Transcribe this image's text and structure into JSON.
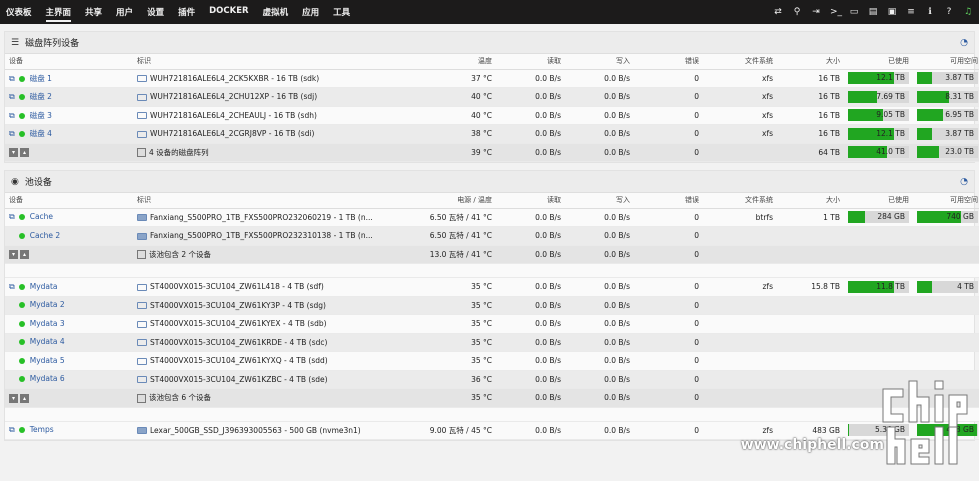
{
  "nav": {
    "items": [
      "仪表板",
      "主界面",
      "共享",
      "用户",
      "设置",
      "插件",
      "DOCKER",
      "虚拟机",
      "应用",
      "工具"
    ],
    "active": "主界面"
  },
  "array": {
    "title": "磁盘阵列设备",
    "headers": [
      "设备",
      "标识",
      "温度",
      "读取",
      "写入",
      "错误",
      "文件系统",
      "大小",
      "已使用",
      "可用空间"
    ],
    "rows": [
      {
        "device": "磁盘 1",
        "id": "WUH721816ALE6L4_2CK5KXBR - 16 TB (sdk)",
        "temp": "37 °C",
        "read": "0.0 B/s",
        "write": "0.0 B/s",
        "errors": "0",
        "fs": "xfs",
        "size": "16 TB",
        "used": "12.1 TB",
        "used_pct": 0.76,
        "free": "3.87 TB",
        "free_pct": 0.24
      },
      {
        "device": "磁盘 2",
        "id": "WUH721816ALE6L4_2CHU12XP - 16 TB (sdj)",
        "temp": "40 °C",
        "read": "0.0 B/s",
        "write": "0.0 B/s",
        "errors": "0",
        "fs": "xfs",
        "size": "16 TB",
        "used": "7.69 TB",
        "used_pct": 0.48,
        "free": "8.31 TB",
        "free_pct": 0.52
      },
      {
        "device": "磁盘 3",
        "id": "WUH721816ALE6L4_2CHEAULJ - 16 TB (sdh)",
        "temp": "40 °C",
        "read": "0.0 B/s",
        "write": "0.0 B/s",
        "errors": "0",
        "fs": "xfs",
        "size": "16 TB",
        "used": "9.05 TB",
        "used_pct": 0.57,
        "free": "6.95 TB",
        "free_pct": 0.43
      },
      {
        "device": "磁盘 4",
        "id": "WUH721816ALE6L4_2CGRJ8VP - 16 TB (sdi)",
        "temp": "38 °C",
        "read": "0.0 B/s",
        "write": "0.0 B/s",
        "errors": "0",
        "fs": "xfs",
        "size": "16 TB",
        "used": "12.1 TB",
        "used_pct": 0.76,
        "free": "3.87 TB",
        "free_pct": 0.24
      }
    ],
    "total": {
      "id": "4 设备的磁盘阵列",
      "temp": "39 °C",
      "read": "0.0 B/s",
      "write": "0.0 B/s",
      "errors": "0",
      "size": "64 TB",
      "used": "41.0 TB",
      "used_pct": 0.64,
      "free": "23.0 TB",
      "free_pct": 0.36
    }
  },
  "pool": {
    "title": "池设备",
    "headers": [
      "设备",
      "标识",
      "电源 / 温度",
      "读取",
      "写入",
      "错误",
      "文件系统",
      "大小",
      "已使用",
      "可用空间"
    ],
    "cache": [
      {
        "device": "Cache",
        "id": "Fanxiang_S500PRO_1TB_FXS500PRO232060219 - 1 TB (n...",
        "temp": "6.50 瓦特 / 41 °C",
        "read": "0.0 B/s",
        "write": "0.0 B/s",
        "errors": "0",
        "fs": "btrfs",
        "size": "1 TB",
        "used": "284 GB",
        "used_pct": 0.28,
        "free": "740 GB",
        "free_pct": 0.72
      },
      {
        "device": "Cache 2",
        "id": "Fanxiang_S500PRO_1TB_FXS500PRO232310138 - 1 TB (n...",
        "temp": "6.50 瓦特 / 41 °C",
        "read": "0.0 B/s",
        "write": "0.0 B/s",
        "errors": "0"
      }
    ],
    "cache_total": {
      "id": "该池包含 2 个设备",
      "temp": "13.0 瓦特 / 41 °C",
      "read": "0.0 B/s",
      "write": "0.0 B/s",
      "errors": "0"
    },
    "mydata": [
      {
        "device": "Mydata",
        "id": "ST4000VX015-3CU104_ZW61L418 - 4 TB (sdf)",
        "temp": "35 °C",
        "read": "0.0 B/s",
        "write": "0.0 B/s",
        "errors": "0",
        "fs": "zfs",
        "size": "15.8 TB",
        "used": "11.8 TB",
        "used_pct": 0.75,
        "free": "4 TB",
        "free_pct": 0.25
      },
      {
        "device": "Mydata 2",
        "id": "ST4000VX015-3CU104_ZW61KY3P - 4 TB (sdg)",
        "temp": "35 °C",
        "read": "0.0 B/s",
        "write": "0.0 B/s",
        "errors": "0"
      },
      {
        "device": "Mydata 3",
        "id": "ST4000VX015-3CU104_ZW61KYEX - 4 TB (sdb)",
        "temp": "35 °C",
        "read": "0.0 B/s",
        "write": "0.0 B/s",
        "errors": "0"
      },
      {
        "device": "Mydata 4",
        "id": "ST4000VX015-3CU104_ZW61KRDE - 4 TB (sdc)",
        "temp": "35 °C",
        "read": "0.0 B/s",
        "write": "0.0 B/s",
        "errors": "0"
      },
      {
        "device": "Mydata 5",
        "id": "ST4000VX015-3CU104_ZW61KYXQ - 4 TB (sdd)",
        "temp": "35 °C",
        "read": "0.0 B/s",
        "write": "0.0 B/s",
        "errors": "0"
      },
      {
        "device": "Mydata 6",
        "id": "ST4000VX015-3CU104_ZW61KZBC - 4 TB (sde)",
        "temp": "36 °C",
        "read": "0.0 B/s",
        "write": "0.0 B/s",
        "errors": "0"
      }
    ],
    "mydata_total": {
      "id": "该池包含 6 个设备",
      "temp": "35 °C",
      "read": "0.0 B/s",
      "write": "0.0 B/s",
      "errors": "0"
    },
    "temps": {
      "device": "Temps",
      "id": "Lexar_500GB_SSD_J396393005563 - 500 GB (nvme3n1)",
      "temp": "9.00 瓦特 / 45 °C",
      "read": "0.0 B/s",
      "write": "0.0 B/s",
      "errors": "0",
      "fs": "zfs",
      "size": "483 GB",
      "used": "5.36 GB",
      "used_pct": 0.02,
      "free": "478 GB",
      "free_pct": 0.98
    }
  },
  "watermark": {
    "text": "www.chiphell.com"
  },
  "colors": {
    "bar_fill": "#21a621",
    "bar_bg": "#d8d8d8",
    "nav_bg": "#1c1b1b",
    "link": "#2c5aa0",
    "status_ok": "#27c027"
  }
}
